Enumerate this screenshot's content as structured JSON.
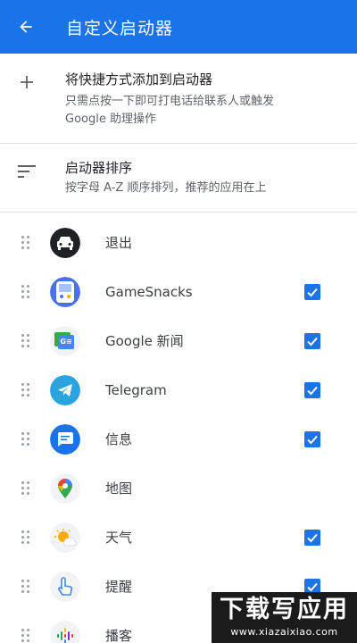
{
  "header": {
    "title": "自定义启动器",
    "back_icon": "arrow-back-icon"
  },
  "settings": {
    "add": {
      "icon": "plus-icon",
      "title": "将快捷方式添加到启动器",
      "subtitle_line1": "只需点按一下即可打电话给联系人或触发",
      "subtitle_line2": "Google 助理操作"
    },
    "sort": {
      "icon": "sort-icon",
      "title": "启动器排序",
      "subtitle": "按字母 A-Z 顺序排列，推荐的应用在上"
    }
  },
  "apps": [
    {
      "name": "退出",
      "icon": "exit-car-icon",
      "checked": false
    },
    {
      "name": "GameSnacks",
      "icon": "gamesnacks-icon",
      "checked": true
    },
    {
      "name": "Google 新闻",
      "icon": "google-news-icon",
      "checked": true
    },
    {
      "name": "Telegram",
      "icon": "telegram-icon",
      "checked": true
    },
    {
      "name": "信息",
      "icon": "messages-icon",
      "checked": true
    },
    {
      "name": "地图",
      "icon": "maps-icon",
      "checked": false
    },
    {
      "name": "天气",
      "icon": "weather-icon",
      "checked": true
    },
    {
      "name": "提醒",
      "icon": "reminders-icon",
      "checked": true
    },
    {
      "name": "播客",
      "icon": "podcasts-icon",
      "checked": true
    }
  ],
  "watermark": {
    "title": "下载写应用",
    "url": "www.xiazaixiao.com"
  },
  "colors": {
    "primary": "#1a73e8",
    "divider": "#e0e0e0"
  }
}
